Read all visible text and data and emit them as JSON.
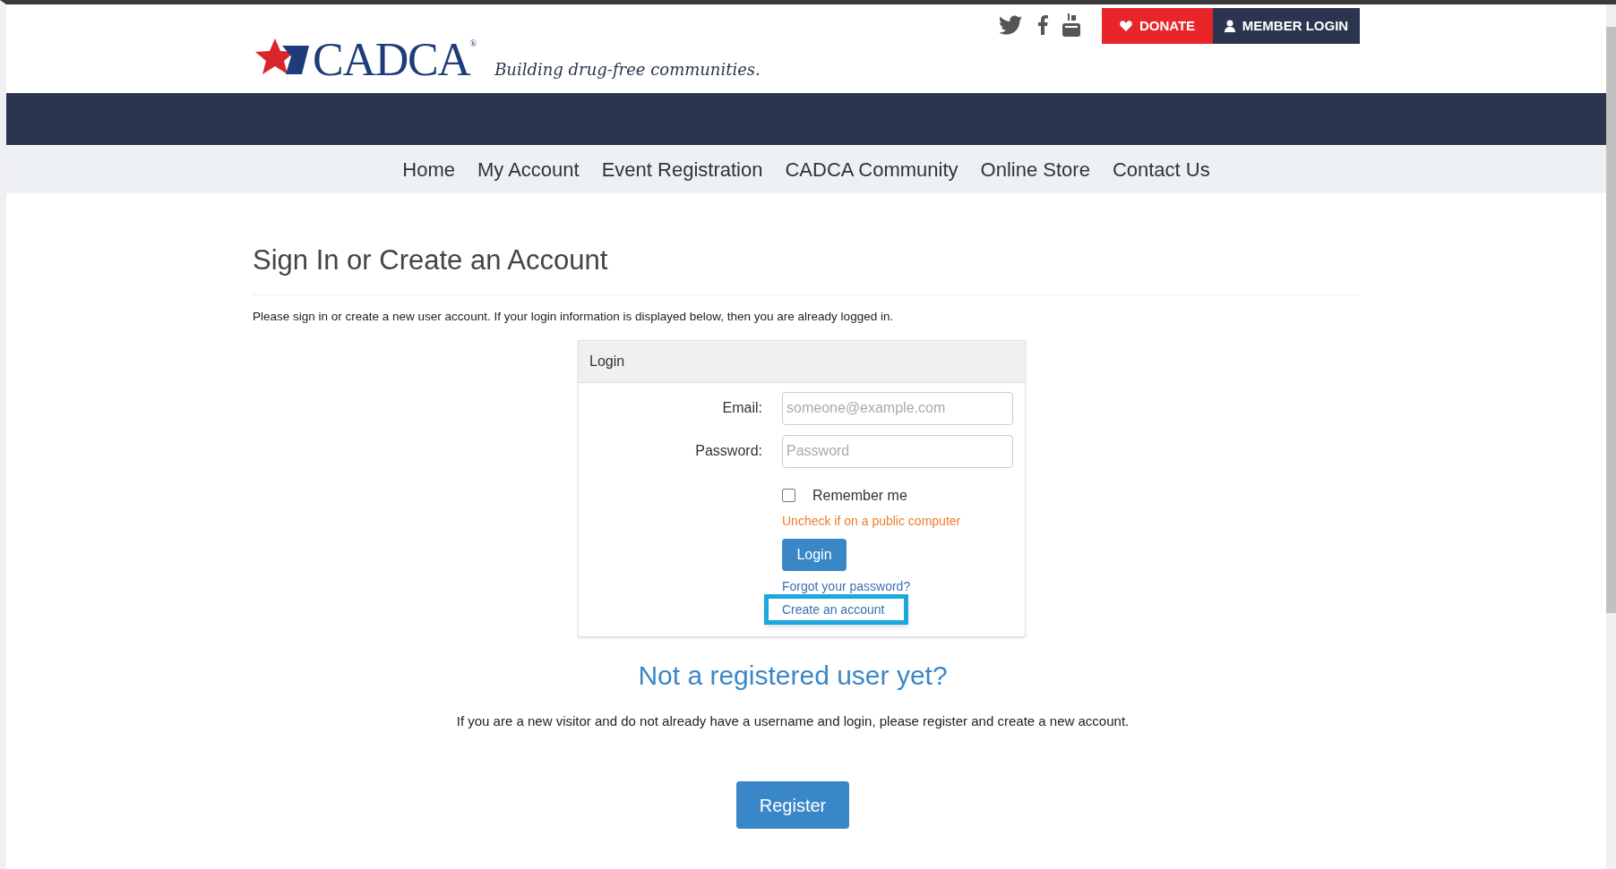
{
  "header": {
    "logo_text": "CADCA",
    "logo_mark": "®",
    "tagline": "Building drug-free communities.",
    "donate_button": "DONATE",
    "member_login_button": "MEMBER LOGIN"
  },
  "nav": [
    {
      "label": "Home"
    },
    {
      "label": "My Account"
    },
    {
      "label": "Event Registration"
    },
    {
      "label": "CADCA Community"
    },
    {
      "label": "Online Store"
    },
    {
      "label": "Contact Us"
    }
  ],
  "page": {
    "title": "Sign In or Create an Account",
    "intro": "Please sign in or create a new user account. If your login information is displayed below, then you are already logged in."
  },
  "login_panel": {
    "title": "Login",
    "email_label": "Email:",
    "email_placeholder": "someone@example.com",
    "password_label": "Password:",
    "password_placeholder": "Password",
    "remember_label": "Remember me",
    "remember_checked": false,
    "remember_hint": "Uncheck if on a public computer",
    "login_button": "Login",
    "forgot_link": "Forgot your password?",
    "create_link": "Create an account",
    "create_highlighted": true
  },
  "register": {
    "title": "Not a registered user yet?",
    "text": "If you are a new visitor and do not already have a username and login, please register and create a new account.",
    "button": "Register"
  }
}
